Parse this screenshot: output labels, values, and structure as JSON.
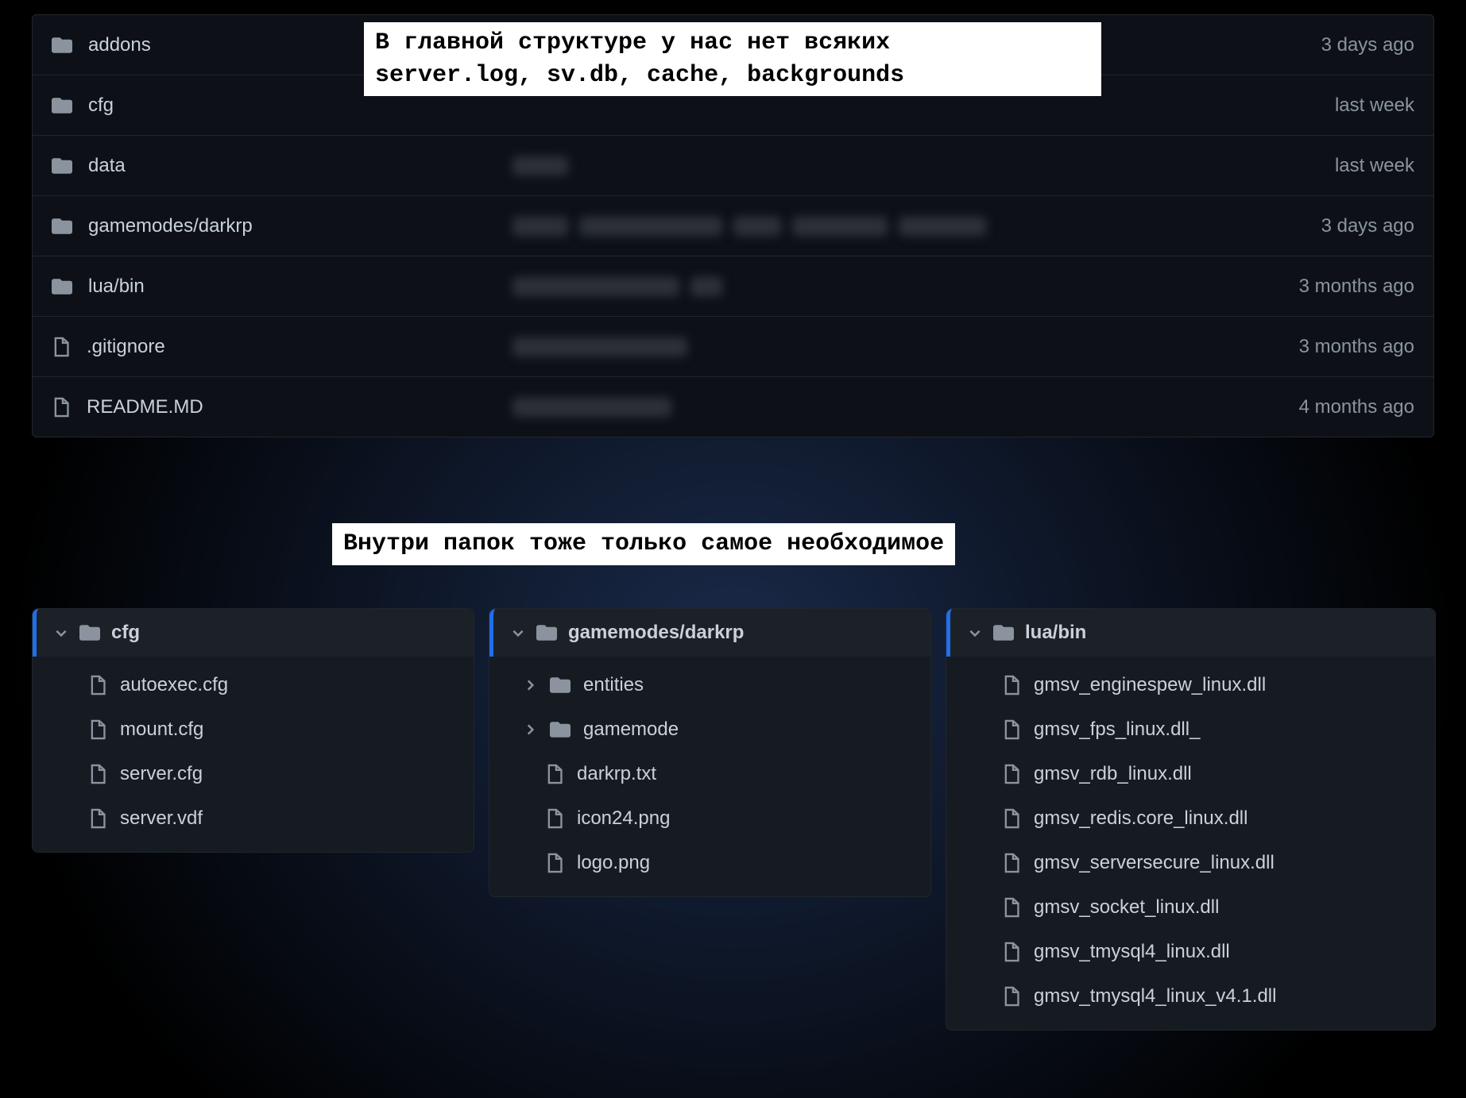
{
  "annotations": {
    "top": "В главной структуре у нас нет всяких\nserver.log, sv.db, cache, backgrounds",
    "mid": "Внутри папок тоже только самое необходимое"
  },
  "main_list": [
    {
      "type": "folder",
      "name": "addons",
      "age": "3 days ago",
      "blur": [
        90
      ]
    },
    {
      "type": "folder",
      "name": "cfg",
      "age": "last week",
      "blur": []
    },
    {
      "type": "folder",
      "name": "data",
      "age": "last week",
      "blur": [
        70
      ]
    },
    {
      "type": "folder",
      "name": "gamemodes/darkrp",
      "age": "3 days ago",
      "blur": [
        70,
        180,
        60,
        120,
        110
      ]
    },
    {
      "type": "folder",
      "name": "lua/bin",
      "age": "3 months ago",
      "blur": [
        210,
        40
      ]
    },
    {
      "type": "file",
      "name": ".gitignore",
      "age": "3 months ago",
      "blur": [
        220
      ]
    },
    {
      "type": "file",
      "name": "README.MD",
      "age": "4 months ago",
      "blur": [
        200
      ]
    }
  ],
  "trees": {
    "cfg": {
      "title": "cfg",
      "items": [
        {
          "type": "file",
          "name": "autoexec.cfg"
        },
        {
          "type": "file",
          "name": "mount.cfg"
        },
        {
          "type": "file",
          "name": "server.cfg"
        },
        {
          "type": "file",
          "name": "server.vdf"
        }
      ]
    },
    "gamemodes": {
      "title": "gamemodes/darkrp",
      "items": [
        {
          "type": "folder",
          "name": "entities",
          "collapsed": true
        },
        {
          "type": "folder",
          "name": "gamemode",
          "collapsed": true
        },
        {
          "type": "file",
          "name": "darkrp.txt"
        },
        {
          "type": "file",
          "name": "icon24.png"
        },
        {
          "type": "file",
          "name": "logo.png"
        }
      ]
    },
    "luabin": {
      "title": "lua/bin",
      "items": [
        {
          "type": "file",
          "name": "gmsv_enginespew_linux.dll"
        },
        {
          "type": "file",
          "name": "gmsv_fps_linux.dll_"
        },
        {
          "type": "file",
          "name": "gmsv_rdb_linux.dll"
        },
        {
          "type": "file",
          "name": "gmsv_redis.core_linux.dll"
        },
        {
          "type": "file",
          "name": "gmsv_serversecure_linux.dll"
        },
        {
          "type": "file",
          "name": "gmsv_socket_linux.dll"
        },
        {
          "type": "file",
          "name": "gmsv_tmysql4_linux.dll"
        },
        {
          "type": "file",
          "name": "gmsv_tmysql4_linux_v4.1.dll"
        }
      ]
    }
  }
}
